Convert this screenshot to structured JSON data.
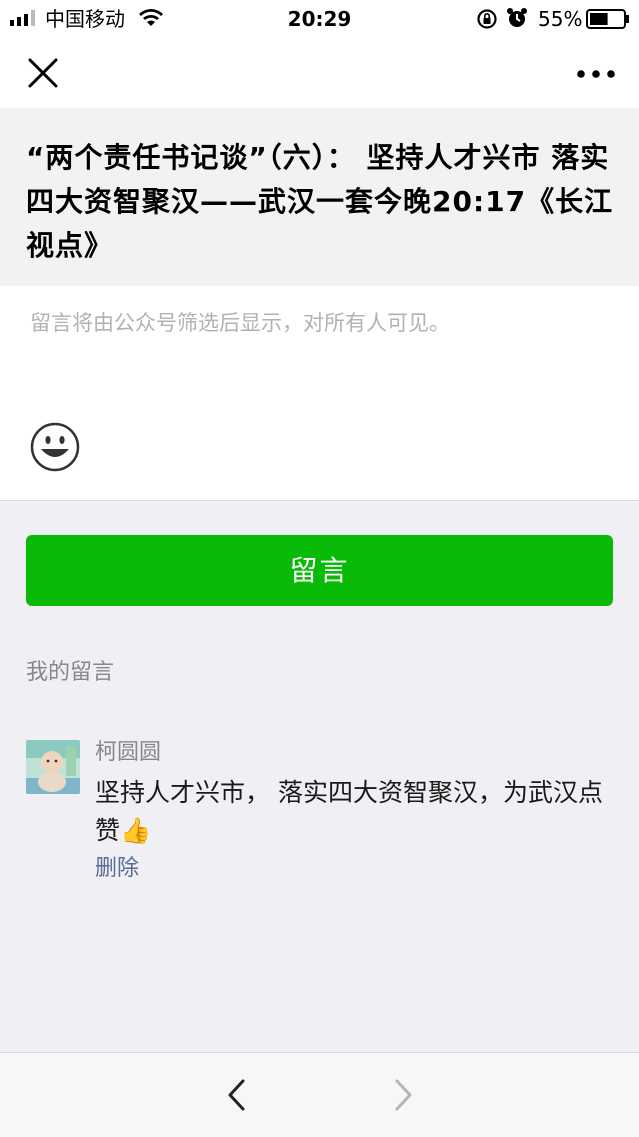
{
  "status_bar": {
    "carrier": "中国移动",
    "time": "20:29",
    "battery_percent": "55%",
    "battery_level": 0.55,
    "icons": [
      "signal-icon",
      "wifi-icon",
      "rotation-lock-icon",
      "alarm-icon",
      "battery-icon"
    ]
  },
  "nav": {
    "close_icon": "close-icon",
    "more_icon": "more-dots-icon"
  },
  "article": {
    "title": "“两个责任书记谈”（六）： 坚持人才兴市 落实四大资智聚汉——武汉一套今晚20:17《长江视点》"
  },
  "comment_input": {
    "placeholder": "留言将由公众号筛选后显示，对所有人可见。",
    "emoji_icon": "smiley-icon"
  },
  "submit": {
    "label": "留言",
    "color": "#09bb07"
  },
  "my_comments": {
    "section_label": "我的留言",
    "items": [
      {
        "nickname": "柯圆圆",
        "text": "坚持人才兴市， 落实四大资智聚汉，为武汉点赞👍",
        "delete_label": "删除"
      }
    ]
  },
  "toolbar": {
    "back_icon": "chevron-left-icon",
    "forward_icon": "chevron-right-icon"
  }
}
